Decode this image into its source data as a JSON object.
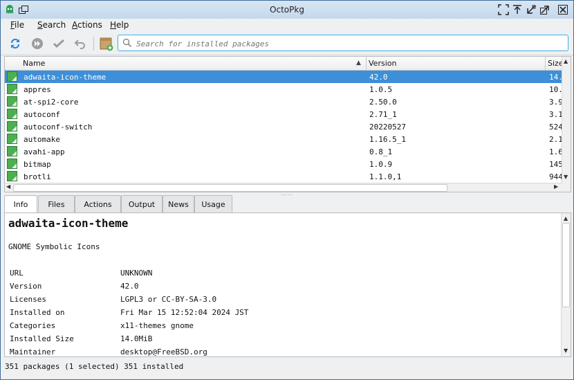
{
  "window": {
    "title": "OctoPkg"
  },
  "menu": [
    {
      "label": "File",
      "mnemonic": "F",
      "rest": "ile"
    },
    {
      "label": "Search",
      "mnemonic": "S",
      "rest": "earch"
    },
    {
      "label": "Actions",
      "mnemonic": "A",
      "rest": "ctions"
    },
    {
      "label": "Help",
      "mnemonic": "H",
      "rest": "elp"
    }
  ],
  "toolbar": {
    "icons": [
      "sync-icon",
      "run-icon",
      "commit-icon",
      "undo-icon",
      "package-install-icon"
    ],
    "search_placeholder": "Search for installed packages",
    "search_value": ""
  },
  "table": {
    "headers": {
      "name": "Name",
      "version": "Version",
      "size": "Size"
    },
    "sort_indicator": "▲",
    "rows": [
      {
        "name": "adwaita-icon-theme",
        "version": "42.0",
        "size": "14.",
        "selected": true
      },
      {
        "name": "appres",
        "version": "1.0.5",
        "size": "10."
      },
      {
        "name": "at-spi2-core",
        "version": "2.50.0",
        "size": "3.9"
      },
      {
        "name": "autoconf",
        "version": "2.71_1",
        "size": "3.1"
      },
      {
        "name": "autoconf-switch",
        "version": "20220527",
        "size": "524"
      },
      {
        "name": "automake",
        "version": "1.16.5_1",
        "size": "2.1"
      },
      {
        "name": "avahi-app",
        "version": "0.8_1",
        "size": "1.6"
      },
      {
        "name": "bitmap",
        "version": "1.0.9",
        "size": "145"
      },
      {
        "name": "brotli",
        "version": "1.1.0,1",
        "size": "944"
      }
    ]
  },
  "tabs": [
    {
      "label": "Info",
      "active": true
    },
    {
      "label": "Files"
    },
    {
      "label": "Actions"
    },
    {
      "label": "Output"
    },
    {
      "label": "News"
    },
    {
      "label": "Usage"
    }
  ],
  "info": {
    "name": "adwaita-icon-theme",
    "description": "GNOME Symbolic Icons",
    "fields": [
      {
        "key": "URL",
        "value": "UNKNOWN"
      },
      {
        "key": "Version",
        "value": "42.0"
      },
      {
        "key": "Licenses",
        "value": "LGPL3 or CC-BY-SA-3.0"
      },
      {
        "key": "Installed on",
        "value": "Fri Mar 15 12:52:04 2024 JST"
      },
      {
        "key": "Categories",
        "value": "x11-themes gnome"
      },
      {
        "key": "Installed Size",
        "value": "14.0MiB"
      },
      {
        "key": "Maintainer",
        "value": "desktop@FreeBSD.org"
      }
    ]
  },
  "status": {
    "text": "351 packages (1 selected)  351 installed"
  },
  "colors": {
    "accent": "#3daee9",
    "selection": "#3d8fd8",
    "pkg_icon": "#4caf50"
  }
}
